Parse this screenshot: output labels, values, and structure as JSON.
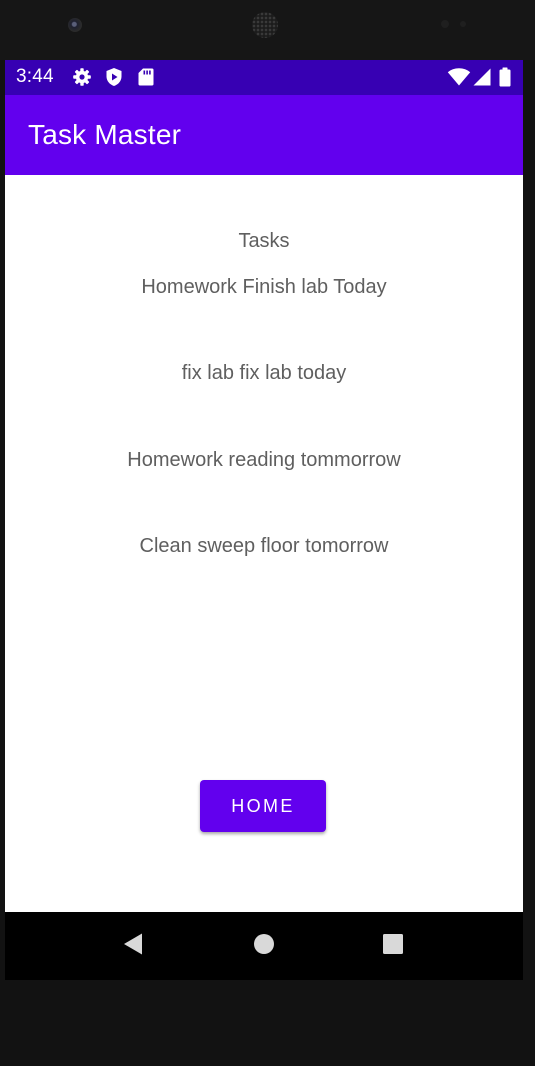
{
  "status_bar": {
    "time": "3:44",
    "left_icons": [
      "gear-icon",
      "shield-icon",
      "sd-card-icon"
    ],
    "right_icons": [
      "wifi-icon",
      "signal-icon",
      "battery-icon"
    ]
  },
  "app_bar": {
    "title": "Task Master"
  },
  "content": {
    "heading": "Tasks",
    "tasks": [
      "Homework Finish lab Today",
      "fix lab fix lab today",
      "Homework reading tommorrow",
      "Clean sweep floor tomorrow"
    ],
    "home_button_label": "HOME"
  },
  "nav_bar": {
    "buttons": [
      "back-icon",
      "home-circle-icon",
      "recents-square-icon"
    ]
  },
  "colors": {
    "status_bar": "#3700b3",
    "app_bar": "#6200ee",
    "button": "#6200ee",
    "text": "#5f5f5f"
  }
}
